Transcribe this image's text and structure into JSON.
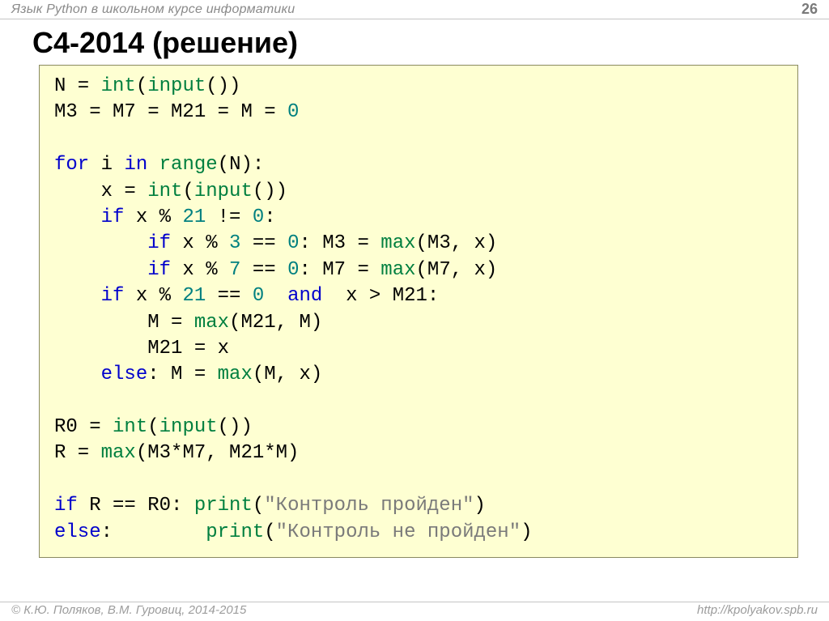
{
  "header": {
    "title": "Язык Python в школьном курсе информатики",
    "page_number": "26"
  },
  "slide": {
    "title": "С4-2014 (решение)"
  },
  "code": {
    "t": {
      "N": "N = ",
      "int": "int",
      "lp": "(",
      "input": "input",
      "rp": ")",
      "rp2": "())",
      "M_init": "M3 = M7 = M21 = M = ",
      "zero": "0",
      "for": "for",
      "i_in": " i ",
      "in": "in",
      "range": "range",
      "Nparen": "(N):",
      "x_eq": "    x = ",
      "if": "if",
      "x_mod": " x % ",
      "n21": "21",
      "neq0": " != ",
      "colon": ":",
      "indent8": "        ",
      "indent4": "    ",
      "n3": "3",
      "eqeq": " == ",
      "m3eq": ": M3 = ",
      "max": "max",
      "m3x": "(M3, x)",
      "n7": "7",
      "m7eq": ": M7 = ",
      "m7x": "(M7, x)",
      "and": "and",
      "xgt": "  x > M21:",
      "Meq": "        M = ",
      "m21m": "(M21, M)",
      "m21x": "        M21 = x",
      "else": "else",
      "Meq2": ": M = ",
      "mx": "(M, x)",
      "R0": "R0 = ",
      "Req": "R = ",
      "m3m7": "(M3*M7, M21*M)",
      "ReqR0": " R == R0: ",
      "print": "print",
      "s1": "\"Контроль пройден\"",
      "s2": "\"Контроль не пройден\"",
      "elsepad": ":        "
    }
  },
  "footer": {
    "left": "© К.Ю. Поляков, В.М. Гуровиц, 2014-2015",
    "right": "http://kpolyakov.spb.ru"
  }
}
